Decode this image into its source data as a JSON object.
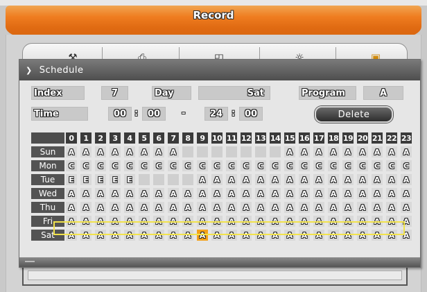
{
  "window": {
    "title": "Record"
  },
  "tabs": [
    {
      "icon": "tools-icon",
      "glyph": "⚒",
      "active": false
    },
    {
      "icon": "recorder-icon",
      "glyph": "⎙",
      "active": false
    },
    {
      "icon": "camera-icon",
      "glyph": "◰",
      "active": false
    },
    {
      "icon": "sun-icon",
      "glyph": "☼",
      "active": false
    },
    {
      "icon": "record-icon",
      "glyph": "▣",
      "active": true
    }
  ],
  "dialog": {
    "title": "Schedule",
    "index_label": "Index",
    "index_value": "7",
    "day_label": "Day",
    "day_value": "Sat",
    "program_label": "Program",
    "program_value": "A",
    "time_label": "Time",
    "start_hour": "00",
    "start_min": "00",
    "end_hour": "24",
    "end_min": "00",
    "colon": ":",
    "dash": "-",
    "delete_label": "Delete"
  },
  "schedule": {
    "hours": [
      "0",
      "1",
      "2",
      "3",
      "4",
      "5",
      "6",
      "7",
      "8",
      "9",
      "10",
      "11",
      "12",
      "13",
      "14",
      "15",
      "16",
      "17",
      "18",
      "19",
      "20",
      "21",
      "22",
      "23"
    ],
    "rows": [
      {
        "day": "Sun",
        "cells": [
          "A",
          "A",
          "A",
          "A",
          "A",
          "A",
          "A",
          "A",
          "",
          "",
          "",
          "",
          "",
          "",
          "",
          "A",
          "A",
          "A",
          "A",
          "A",
          "A",
          "A",
          "A",
          "A"
        ]
      },
      {
        "day": "Mon",
        "cells": [
          "C",
          "C",
          "C",
          "C",
          "C",
          "C",
          "C",
          "C",
          "C",
          "C",
          "C",
          "C",
          "C",
          "C",
          "C",
          "C",
          "C",
          "C",
          "C",
          "C",
          "C",
          "C",
          "C",
          "C"
        ]
      },
      {
        "day": "Tue",
        "cells": [
          "E",
          "E",
          "E",
          "E",
          "E",
          "",
          "",
          "",
          "",
          "A",
          "A",
          "A",
          "A",
          "A",
          "A",
          "A",
          "A",
          "A",
          "A",
          "A",
          "A",
          "A",
          "A",
          "A"
        ]
      },
      {
        "day": "Wed",
        "cells": [
          "A",
          "A",
          "A",
          "A",
          "A",
          "A",
          "A",
          "A",
          "A",
          "A",
          "A",
          "A",
          "A",
          "A",
          "A",
          "A",
          "A",
          "A",
          "A",
          "A",
          "A",
          "A",
          "A",
          "A"
        ]
      },
      {
        "day": "Thu",
        "cells": [
          "A",
          "A",
          "A",
          "A",
          "A",
          "A",
          "A",
          "A",
          "A",
          "A",
          "A",
          "A",
          "A",
          "A",
          "A",
          "A",
          "A",
          "A",
          "A",
          "A",
          "A",
          "A",
          "A",
          "A"
        ]
      },
      {
        "day": "Fri",
        "cells": [
          "A",
          "A",
          "A",
          "A",
          "A",
          "A",
          "A",
          "A",
          "A",
          "A",
          "A",
          "A",
          "A",
          "A",
          "A",
          "A",
          "A",
          "A",
          "A",
          "A",
          "A",
          "A",
          "A",
          "A"
        ]
      },
      {
        "day": "Sat",
        "cells": [
          "A",
          "A",
          "A",
          "A",
          "A",
          "A",
          "A",
          "A",
          "A",
          "A",
          "A",
          "A",
          "A",
          "A",
          "A",
          "A",
          "A",
          "A",
          "A",
          "A",
          "A",
          "A",
          "A",
          "A"
        ]
      }
    ],
    "selected_row": 6,
    "selected_col": 9
  },
  "colors": {
    "accent": "#ef7d20",
    "selected_cell": "#f3a21c",
    "row_highlight": "#f1e24b"
  }
}
